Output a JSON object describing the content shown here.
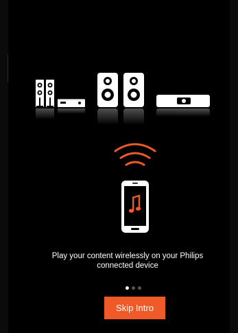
{
  "intro": {
    "caption_line1": "Play your content wirelessly on your Philips",
    "caption_line2": "connected device",
    "skip_label": "Skip Intro"
  },
  "pager": {
    "page_count": 3,
    "current_page": 1
  },
  "colors": {
    "background": "#000000",
    "accent": "#f05a28",
    "device_white": "#ffffff"
  },
  "icons": {
    "devices": "speakers-and-soundbar-illustration",
    "wifi": "wifi-signal-icon",
    "phone": "smartphone-music-icon"
  }
}
